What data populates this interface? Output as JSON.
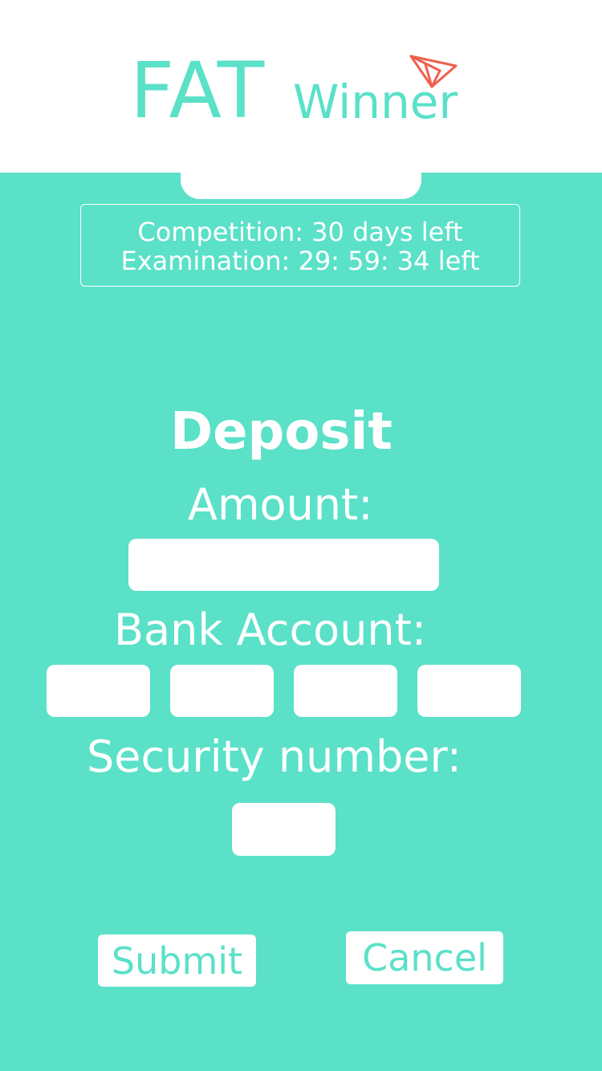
{
  "app": {
    "logo_main": "FAT",
    "logo_sub": "Winner",
    "logo_icon": "paper-plane-icon",
    "accent_color": "#5ae1c8",
    "icon_color": "#f0604d"
  },
  "countdown": {
    "competition": "Competition: 30 days left",
    "examination": "Examination: 29: 59: 34 left"
  },
  "form": {
    "title": "Deposit",
    "amount_label": "Amount:",
    "amount_value": "",
    "bank_label": "Bank Account:",
    "bank_values": [
      "",
      "",
      "",
      ""
    ],
    "security_label": "Security number:",
    "security_value": ""
  },
  "actions": {
    "submit_label": "Submit",
    "cancel_label": "Cancel"
  }
}
